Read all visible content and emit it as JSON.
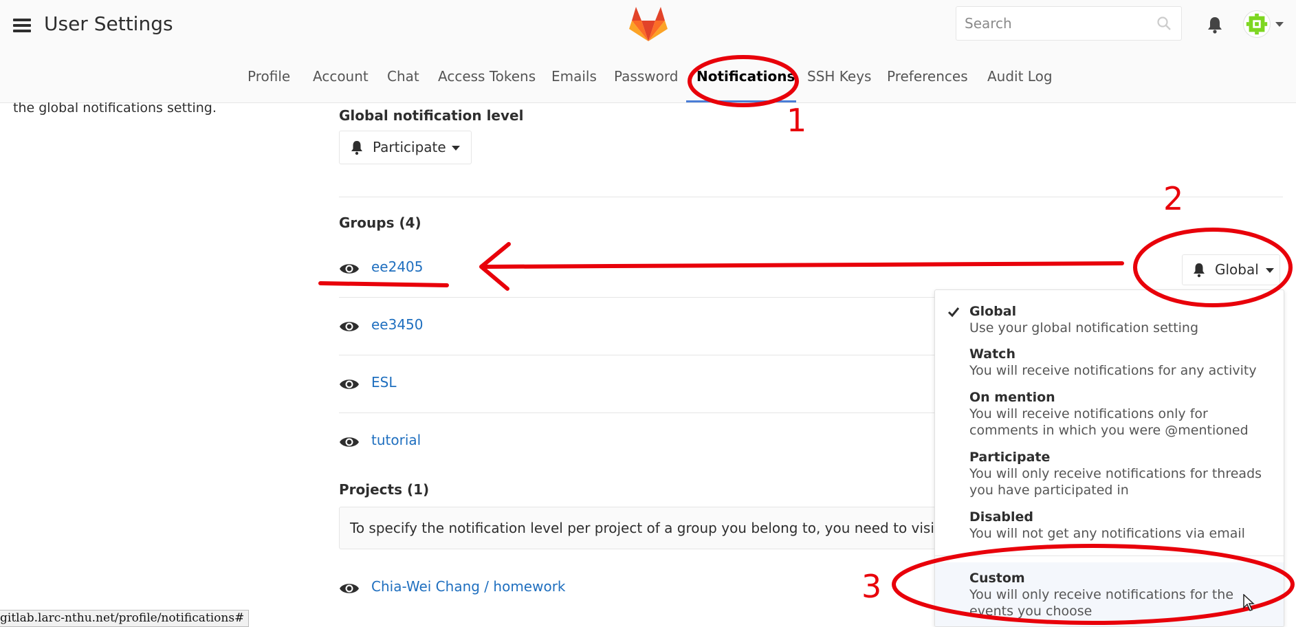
{
  "header": {
    "title": "User Settings",
    "search_placeholder": "Search"
  },
  "nav": {
    "tabs": [
      {
        "label": "Profile"
      },
      {
        "label": "Account"
      },
      {
        "label": "Chat"
      },
      {
        "label": "Access Tokens"
      },
      {
        "label": "Emails"
      },
      {
        "label": "Password"
      },
      {
        "label": "Notifications",
        "active": true
      },
      {
        "label": "SSH Keys"
      },
      {
        "label": "Preferences"
      },
      {
        "label": "Audit Log"
      }
    ]
  },
  "left_description": "the global notifications setting.",
  "global": {
    "label": "Global notification level",
    "value": "Participate"
  },
  "groups": {
    "label": "Groups (4)",
    "items": [
      {
        "name": "ee2405"
      },
      {
        "name": "ee3450"
      },
      {
        "name": "ESL"
      },
      {
        "name": "tutorial"
      }
    ],
    "selected_level": "Global"
  },
  "projects": {
    "label": "Projects (1)",
    "info": "To specify the notification level per project of a group you belong to, you need to visit proj",
    "items": [
      {
        "name": "Chia-Wei Chang / homework"
      }
    ]
  },
  "level_menu": {
    "options": [
      {
        "title": "Global",
        "desc": "Use your global notification setting",
        "checked": true
      },
      {
        "title": "Watch",
        "desc": "You will receive notifications for any activity"
      },
      {
        "title": "On mention",
        "desc": "You will receive notifications only for comments in which you were @mentioned"
      },
      {
        "title": "Participate",
        "desc": "You will only receive notifications for threads you have participated in"
      },
      {
        "title": "Disabled",
        "desc": "You will not get any notifications via email"
      },
      {
        "title": "Custom",
        "desc": "You will only receive notifications for the events you choose",
        "hovered": true
      }
    ]
  },
  "status_bar": "gitlab.larc-nthu.net/profile/notifications#",
  "annotations": {
    "numbers": [
      "1",
      "2",
      "3"
    ],
    "color": "#e8000a"
  },
  "colors": {
    "link": "#1f6fbf",
    "accent": "#4a7dd6",
    "logo_orange": "#fc6d26",
    "logo_red": "#e24329",
    "logo_light": "#fca326"
  }
}
